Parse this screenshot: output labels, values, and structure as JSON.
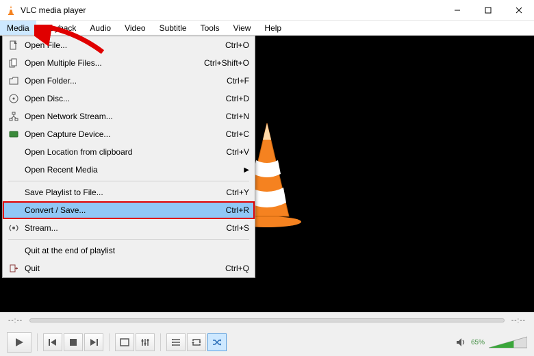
{
  "title": "VLC media player",
  "menubar": [
    "Media",
    "Playback",
    "Audio",
    "Video",
    "Subtitle",
    "Tools",
    "View",
    "Help"
  ],
  "menu_open_index": 0,
  "dropdown": {
    "rows": [
      {
        "icon": "file",
        "label": "Open File...",
        "accel": "Ctrl+O"
      },
      {
        "icon": "files",
        "label": "Open Multiple Files...",
        "accel": "Ctrl+Shift+O"
      },
      {
        "icon": "folder",
        "label": "Open Folder...",
        "accel": "Ctrl+F"
      },
      {
        "icon": "disc",
        "label": "Open Disc...",
        "accel": "Ctrl+D"
      },
      {
        "icon": "network",
        "label": "Open Network Stream...",
        "accel": "Ctrl+N"
      },
      {
        "icon": "capture",
        "label": "Open Capture Device...",
        "accel": "Ctrl+C"
      },
      {
        "icon": "",
        "label": "Open Location from clipboard",
        "accel": "Ctrl+V"
      },
      {
        "icon": "",
        "label": "Open Recent Media",
        "accel": "",
        "submenu": true
      },
      {
        "sep": true
      },
      {
        "icon": "",
        "label": "Save Playlist to File...",
        "accel": "Ctrl+Y"
      },
      {
        "icon": "",
        "label": "Convert / Save...",
        "accel": "Ctrl+R",
        "highlight": true,
        "boxed": true
      },
      {
        "icon": "stream",
        "label": "Stream...",
        "accel": "Ctrl+S"
      },
      {
        "sep": true
      },
      {
        "icon": "",
        "label": "Quit at the end of playlist",
        "accel": ""
      },
      {
        "icon": "quit",
        "label": "Quit",
        "accel": "Ctrl+Q"
      }
    ]
  },
  "seek": {
    "left": "--:--",
    "right": "--:--"
  },
  "volume": {
    "pct": "65%",
    "level": 0.65
  }
}
